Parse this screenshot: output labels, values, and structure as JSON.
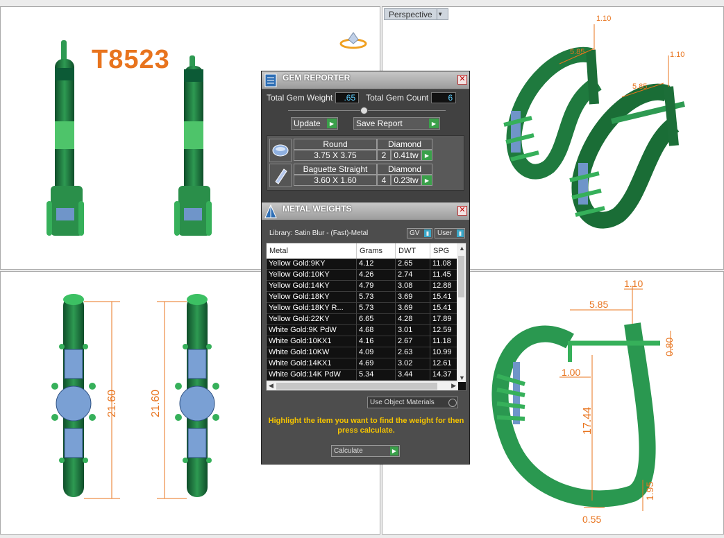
{
  "viewports": {
    "top_right_label": "Perspective",
    "model_title": "T8523"
  },
  "dimensions": {
    "height_a": "21.60",
    "height_b": "21.60",
    "side_width": "5.85",
    "side_wire": "1.10",
    "side_gap": "1.00",
    "side_post": "0.80",
    "side_height": "17.44",
    "side_bottom": "1.95",
    "side_base": "0.55",
    "persp_a": "5.85",
    "persp_b": "1.10",
    "persp_c": "5.85",
    "persp_d": "1.10"
  },
  "gem_reporter": {
    "title": "GEM REPORTER",
    "total_weight_label": "Total Gem Weight",
    "total_weight_value": ".65",
    "total_count_label": "Total Gem Count",
    "total_count_value": "6",
    "update_label": "Update",
    "save_label": "Save Report",
    "items": [
      {
        "shape": "Round",
        "type": "Diamond",
        "size": "3.75 X 3.75",
        "count": "2",
        "weight": "0.41tw"
      },
      {
        "shape": "Baguette Straight",
        "type": "Diamond",
        "size": "3.60 X 1.60",
        "count": "4",
        "weight": "0.23tw"
      }
    ],
    "close_icon": "close-icon"
  },
  "metal_weights": {
    "title": "METAL WEIGHTS",
    "library": "Library: Satin Blur - (Fast)-Metal",
    "gv_label": "GV",
    "user_label": "User",
    "columns": [
      "Metal",
      "Grams",
      "DWT",
      "SPG"
    ],
    "rows": [
      [
        "Yellow Gold:9KY",
        "4.12",
        "2.65",
        "11.08"
      ],
      [
        "Yellow Gold:10KY",
        "4.26",
        "2.74",
        "11.45"
      ],
      [
        "Yellow Gold:14KY",
        "4.79",
        "3.08",
        "12.88"
      ],
      [
        "Yellow Gold:18KY",
        "5.73",
        "3.69",
        "15.41"
      ],
      [
        "Yellow Gold:18KY R...",
        "5.73",
        "3.69",
        "15.41"
      ],
      [
        "Yellow Gold:22KY",
        "6.65",
        "4.28",
        "17.89"
      ],
      [
        "White Gold:9K PdW",
        "4.68",
        "3.01",
        "12.59"
      ],
      [
        "White Gold:10KX1",
        "4.16",
        "2.67",
        "11.18"
      ],
      [
        "White Gold:10KW",
        "4.09",
        "2.63",
        "10.99"
      ],
      [
        "White Gold:14KX1",
        "4.69",
        "3.02",
        "12.61"
      ],
      [
        "White Gold:14K PdW",
        "5.34",
        "3.44",
        "14.37"
      ]
    ],
    "use_object_materials": "Use Object Materials",
    "hint": "Highlight the item you want to find the weight for then press calculate.",
    "calculate_label": "Calculate"
  }
}
